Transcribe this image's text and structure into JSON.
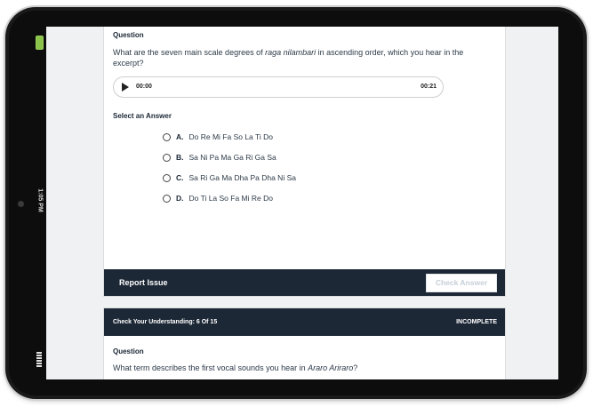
{
  "device": {
    "time": "1:05 PM"
  },
  "question1": {
    "label": "Question",
    "text_before": "What are the seven main scale degrees of ",
    "text_em": "raga nilambari",
    "text_after": " in ascending order, which you hear in the excerpt?",
    "player": {
      "current_time": "00:00",
      "duration": "00:21",
      "play_icon": "play-icon"
    },
    "select_label": "Select an Answer",
    "options": [
      {
        "letter": "A.",
        "text": "Do Re Mi Fa So La Ti Do"
      },
      {
        "letter": "B.",
        "text": "Sa Ni Pa Ma Ga Ri Ga Sa"
      },
      {
        "letter": "C.",
        "text": "Sa Ri Ga Ma Dha Pa Dha Ni Sa"
      },
      {
        "letter": "D.",
        "text": "Do Ti La So Fa Mi Re Do"
      }
    ],
    "report_label": "Report Issue",
    "check_label": "Check Answer"
  },
  "question2": {
    "header": "Check Your Understanding: 6 Of 15",
    "status": "INCOMPLETE",
    "label": "Question",
    "text_before": "What term describes the first vocal sounds you hear in ",
    "text_em": "Araro Ariraro",
    "text_after": "?"
  },
  "colors": {
    "bar": "#1d2836",
    "battery": "#8bc34a"
  }
}
